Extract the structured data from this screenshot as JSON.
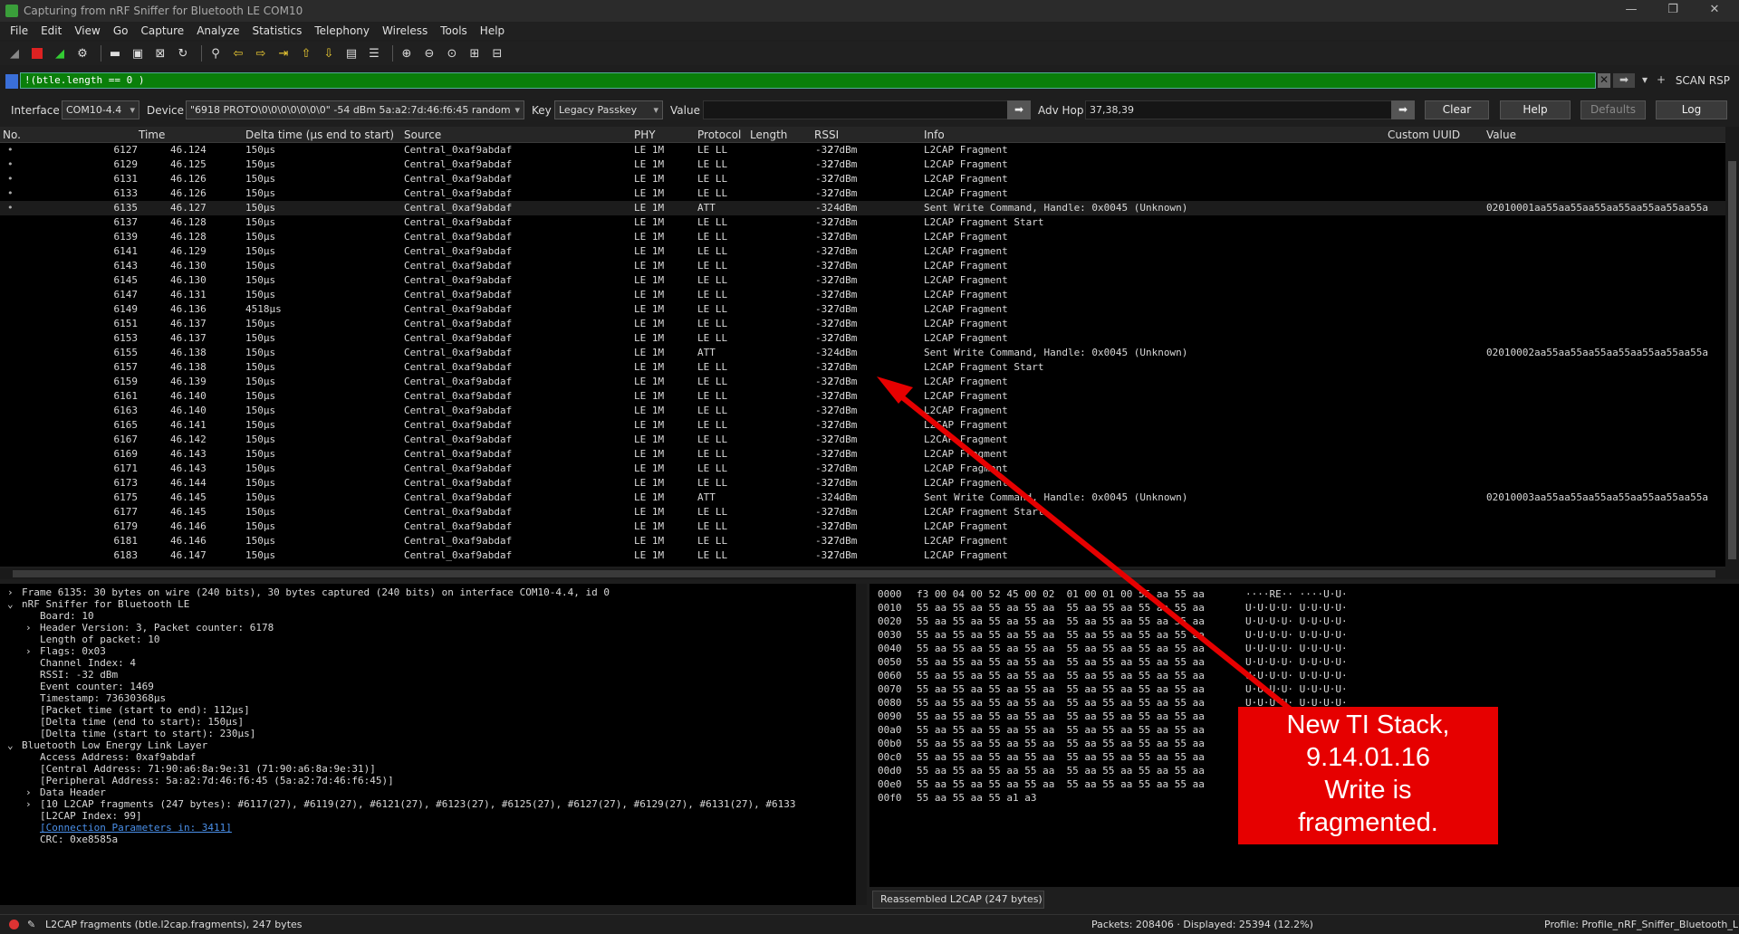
{
  "window": {
    "title": "Capturing from nRF Sniffer for Bluetooth LE COM10"
  },
  "menu": [
    "File",
    "Edit",
    "View",
    "Go",
    "Capture",
    "Analyze",
    "Statistics",
    "Telephony",
    "Wireless",
    "Tools",
    "Help"
  ],
  "filter": {
    "value": "!(btle.length == 0 )",
    "scan_rsp": "SCAN RSP"
  },
  "controls": {
    "interface_label": "Interface",
    "interface_value": "COM10-4.4",
    "device_label": "Device",
    "device_value": "\"6918 PROTO\\0\\0\\0\\0\\0\\0\\0\"  -54 dBm  5a:a2:7d:46:f6:45  random",
    "key_label": "Key",
    "key_value": "Legacy Passkey",
    "value_label": "Value",
    "adv_hop_label": "Adv Hop",
    "adv_hop_value": "37,38,39",
    "clear": "Clear",
    "help": "Help",
    "defaults": "Defaults",
    "log": "Log"
  },
  "columns": [
    "No.",
    "Time",
    "Delta time (µs end to start)",
    "Source",
    "PHY",
    "Protocol",
    "Length",
    "RSSI",
    "Info",
    "Custom UUID",
    "Value"
  ],
  "packets": [
    {
      "no": "6127",
      "time": "46.124",
      "delta": "150µs",
      "src": "Central_0xaf9abdaf",
      "phy": "LE 1M",
      "proto": "LE LL",
      "len": "27",
      "rssi": "-32 dBm",
      "info": "L2CAP Fragment",
      "value": ""
    },
    {
      "no": "6129",
      "time": "46.125",
      "delta": "150µs",
      "src": "Central_0xaf9abdaf",
      "phy": "LE 1M",
      "proto": "LE LL",
      "len": "27",
      "rssi": "-32 dBm",
      "info": "L2CAP Fragment",
      "value": ""
    },
    {
      "no": "6131",
      "time": "46.126",
      "delta": "150µs",
      "src": "Central_0xaf9abdaf",
      "phy": "LE 1M",
      "proto": "LE LL",
      "len": "27",
      "rssi": "-32 dBm",
      "info": "L2CAP Fragment",
      "value": ""
    },
    {
      "no": "6133",
      "time": "46.126",
      "delta": "150µs",
      "src": "Central_0xaf9abdaf",
      "phy": "LE 1M",
      "proto": "LE LL",
      "len": "27",
      "rssi": "-32 dBm",
      "info": "L2CAP Fragment",
      "value": ""
    },
    {
      "no": "6135",
      "time": "46.127",
      "delta": "150µs",
      "src": "Central_0xaf9abdaf",
      "phy": "LE 1M",
      "proto": "ATT",
      "len": "4",
      "rssi": "-32 dBm",
      "info": "Sent Write Command, Handle: 0x0045 (Unknown)",
      "value": "02010001aa55aa55aa55aa55aa55aa55aa55a"
    },
    {
      "no": "6137",
      "time": "46.128",
      "delta": "150µs",
      "src": "Central_0xaf9abdaf",
      "phy": "LE 1M",
      "proto": "LE LL",
      "len": "27",
      "rssi": "-32 dBm",
      "info": "L2CAP Fragment Start",
      "value": ""
    },
    {
      "no": "6139",
      "time": "46.128",
      "delta": "150µs",
      "src": "Central_0xaf9abdaf",
      "phy": "LE 1M",
      "proto": "LE LL",
      "len": "27",
      "rssi": "-32 dBm",
      "info": "L2CAP Fragment",
      "value": ""
    },
    {
      "no": "6141",
      "time": "46.129",
      "delta": "150µs",
      "src": "Central_0xaf9abdaf",
      "phy": "LE 1M",
      "proto": "LE LL",
      "len": "27",
      "rssi": "-32 dBm",
      "info": "L2CAP Fragment",
      "value": ""
    },
    {
      "no": "6143",
      "time": "46.130",
      "delta": "150µs",
      "src": "Central_0xaf9abdaf",
      "phy": "LE 1M",
      "proto": "LE LL",
      "len": "27",
      "rssi": "-32 dBm",
      "info": "L2CAP Fragment",
      "value": ""
    },
    {
      "no": "6145",
      "time": "46.130",
      "delta": "150µs",
      "src": "Central_0xaf9abdaf",
      "phy": "LE 1M",
      "proto": "LE LL",
      "len": "27",
      "rssi": "-32 dBm",
      "info": "L2CAP Fragment",
      "value": ""
    },
    {
      "no": "6147",
      "time": "46.131",
      "delta": "150µs",
      "src": "Central_0xaf9abdaf",
      "phy": "LE 1M",
      "proto": "LE LL",
      "len": "27",
      "rssi": "-32 dBm",
      "info": "L2CAP Fragment",
      "value": ""
    },
    {
      "no": "6149",
      "time": "46.136",
      "delta": "4518µs",
      "src": "Central_0xaf9abdaf",
      "phy": "LE 1M",
      "proto": "LE LL",
      "len": "27",
      "rssi": "-32 dBm",
      "info": "L2CAP Fragment",
      "value": ""
    },
    {
      "no": "6151",
      "time": "46.137",
      "delta": "150µs",
      "src": "Central_0xaf9abdaf",
      "phy": "LE 1M",
      "proto": "LE LL",
      "len": "27",
      "rssi": "-32 dBm",
      "info": "L2CAP Fragment",
      "value": ""
    },
    {
      "no": "6153",
      "time": "46.137",
      "delta": "150µs",
      "src": "Central_0xaf9abdaf",
      "phy": "LE 1M",
      "proto": "LE LL",
      "len": "27",
      "rssi": "-32 dBm",
      "info": "L2CAP Fragment",
      "value": ""
    },
    {
      "no": "6155",
      "time": "46.138",
      "delta": "150µs",
      "src": "Central_0xaf9abdaf",
      "phy": "LE 1M",
      "proto": "ATT",
      "len": "4",
      "rssi": "-32 dBm",
      "info": "Sent Write Command, Handle: 0x0045 (Unknown)",
      "value": "02010002aa55aa55aa55aa55aa55aa55aa55a"
    },
    {
      "no": "6157",
      "time": "46.138",
      "delta": "150µs",
      "src": "Central_0xaf9abdaf",
      "phy": "LE 1M",
      "proto": "LE LL",
      "len": "27",
      "rssi": "-32 dBm",
      "info": "L2CAP Fragment Start",
      "value": ""
    },
    {
      "no": "6159",
      "time": "46.139",
      "delta": "150µs",
      "src": "Central_0xaf9abdaf",
      "phy": "LE 1M",
      "proto": "LE LL",
      "len": "27",
      "rssi": "-32 dBm",
      "info": "L2CAP Fragment",
      "value": ""
    },
    {
      "no": "6161",
      "time": "46.140",
      "delta": "150µs",
      "src": "Central_0xaf9abdaf",
      "phy": "LE 1M",
      "proto": "LE LL",
      "len": "27",
      "rssi": "-32 dBm",
      "info": "L2CAP Fragment",
      "value": ""
    },
    {
      "no": "6163",
      "time": "46.140",
      "delta": "150µs",
      "src": "Central_0xaf9abdaf",
      "phy": "LE 1M",
      "proto": "LE LL",
      "len": "27",
      "rssi": "-32 dBm",
      "info": "L2CAP Fragment",
      "value": ""
    },
    {
      "no": "6165",
      "time": "46.141",
      "delta": "150µs",
      "src": "Central_0xaf9abdaf",
      "phy": "LE 1M",
      "proto": "LE LL",
      "len": "27",
      "rssi": "-32 dBm",
      "info": "L2CAP Fragment",
      "value": ""
    },
    {
      "no": "6167",
      "time": "46.142",
      "delta": "150µs",
      "src": "Central_0xaf9abdaf",
      "phy": "LE 1M",
      "proto": "LE LL",
      "len": "27",
      "rssi": "-32 dBm",
      "info": "L2CAP Fragment",
      "value": ""
    },
    {
      "no": "6169",
      "time": "46.143",
      "delta": "150µs",
      "src": "Central_0xaf9abdaf",
      "phy": "LE 1M",
      "proto": "LE LL",
      "len": "27",
      "rssi": "-32 dBm",
      "info": "L2CAP Fragment",
      "value": ""
    },
    {
      "no": "6171",
      "time": "46.143",
      "delta": "150µs",
      "src": "Central_0xaf9abdaf",
      "phy": "LE 1M",
      "proto": "LE LL",
      "len": "27",
      "rssi": "-32 dBm",
      "info": "L2CAP Fragment",
      "value": ""
    },
    {
      "no": "6173",
      "time": "46.144",
      "delta": "150µs",
      "src": "Central_0xaf9abdaf",
      "phy": "LE 1M",
      "proto": "LE LL",
      "len": "27",
      "rssi": "-32 dBm",
      "info": "L2CAP Fragment",
      "value": ""
    },
    {
      "no": "6175",
      "time": "46.145",
      "delta": "150µs",
      "src": "Central_0xaf9abdaf",
      "phy": "LE 1M",
      "proto": "ATT",
      "len": "4",
      "rssi": "-32 dBm",
      "info": "Sent Write Command, Handle: 0x0045 (Unknown)",
      "value": "02010003aa55aa55aa55aa55aa55aa55aa55a"
    },
    {
      "no": "6177",
      "time": "46.145",
      "delta": "150µs",
      "src": "Central_0xaf9abdaf",
      "phy": "LE 1M",
      "proto": "LE LL",
      "len": "27",
      "rssi": "-32 dBm",
      "info": "L2CAP Fragment Start",
      "value": ""
    },
    {
      "no": "6179",
      "time": "46.146",
      "delta": "150µs",
      "src": "Central_0xaf9abdaf",
      "phy": "LE 1M",
      "proto": "LE LL",
      "len": "27",
      "rssi": "-32 dBm",
      "info": "L2CAP Fragment",
      "value": ""
    },
    {
      "no": "6181",
      "time": "46.146",
      "delta": "150µs",
      "src": "Central_0xaf9abdaf",
      "phy": "LE 1M",
      "proto": "LE LL",
      "len": "27",
      "rssi": "-32 dBm",
      "info": "L2CAP Fragment",
      "value": ""
    },
    {
      "no": "6183",
      "time": "46.147",
      "delta": "150µs",
      "src": "Central_0xaf9abdaf",
      "phy": "LE 1M",
      "proto": "LE LL",
      "len": "27",
      "rssi": "-32 dBm",
      "info": "L2CAP Fragment",
      "value": ""
    }
  ],
  "details": [
    {
      "indent": 0,
      "tw": "›",
      "text": "Frame 6135: 30 bytes on wire (240 bits), 30 bytes captured (240 bits) on interface COM10-4.4, id 0"
    },
    {
      "indent": 0,
      "tw": "⌄",
      "text": "nRF Sniffer for Bluetooth LE"
    },
    {
      "indent": 1,
      "tw": "",
      "text": "Board: 10"
    },
    {
      "indent": 1,
      "tw": "›",
      "text": "Header Version: 3, Packet counter: 6178"
    },
    {
      "indent": 1,
      "tw": "",
      "text": "Length of packet: 10"
    },
    {
      "indent": 1,
      "tw": "›",
      "text": "Flags: 0x03"
    },
    {
      "indent": 1,
      "tw": "",
      "text": "Channel Index: 4"
    },
    {
      "indent": 1,
      "tw": "",
      "text": "RSSI: -32 dBm"
    },
    {
      "indent": 1,
      "tw": "",
      "text": "Event counter: 1469"
    },
    {
      "indent": 1,
      "tw": "",
      "text": "Timestamp: 73630368µs"
    },
    {
      "indent": 1,
      "tw": "",
      "text": "[Packet time (start to end): 112µs]"
    },
    {
      "indent": 1,
      "tw": "",
      "text": "[Delta time (end to start): 150µs]"
    },
    {
      "indent": 1,
      "tw": "",
      "text": "[Delta time (start to start): 230µs]"
    },
    {
      "indent": 0,
      "tw": "⌄",
      "text": "Bluetooth Low Energy Link Layer"
    },
    {
      "indent": 1,
      "tw": "",
      "text": "Access Address: 0xaf9abdaf"
    },
    {
      "indent": 1,
      "tw": "",
      "text": "[Central Address: 71:90:a6:8a:9e:31 (71:90:a6:8a:9e:31)]"
    },
    {
      "indent": 1,
      "tw": "",
      "text": "[Peripheral Address: 5a:a2:7d:46:f6:45 (5a:a2:7d:46:f6:45)]"
    },
    {
      "indent": 1,
      "tw": "›",
      "text": "Data Header"
    },
    {
      "indent": 1,
      "tw": "›",
      "text": "[10 L2CAP fragments (247 bytes): #6117(27), #6119(27), #6121(27), #6123(27), #6125(27), #6127(27), #6129(27), #6131(27), #6133"
    },
    {
      "indent": 1,
      "tw": "",
      "text": "[L2CAP Index: 99]"
    },
    {
      "indent": 1,
      "tw": "",
      "text": "[Connection Parameters in: 3411]",
      "link": true
    },
    {
      "indent": 1,
      "tw": "",
      "text": "CRC: 0xe8585a"
    }
  ],
  "hex_rows": [
    {
      "off": "0000",
      "bytes": "f3 00 04 00 52 45 00 02  01 00 01 00 55 aa 55 aa",
      "ascii": "····RE·· ····U·U·"
    },
    {
      "off": "0010",
      "bytes": "55 aa 55 aa 55 aa 55 aa  55 aa 55 aa 55 aa 55 aa",
      "ascii": "U·U·U·U· U·U·U·U·"
    },
    {
      "off": "0020",
      "bytes": "55 aa 55 aa 55 aa 55 aa  55 aa 55 aa 55 aa 55 aa",
      "ascii": "U·U·U·U· U·U·U·U·"
    },
    {
      "off": "0030",
      "bytes": "55 aa 55 aa 55 aa 55 aa  55 aa 55 aa 55 aa 55 aa",
      "ascii": "U·U·U·U· U·U·U·U·"
    },
    {
      "off": "0040",
      "bytes": "55 aa 55 aa 55 aa 55 aa  55 aa 55 aa 55 aa 55 aa",
      "ascii": "U·U·U·U· U·U·U·U·"
    },
    {
      "off": "0050",
      "bytes": "55 aa 55 aa 55 aa 55 aa  55 aa 55 aa 55 aa 55 aa",
      "ascii": "U·U·U·U· U·U·U·U·"
    },
    {
      "off": "0060",
      "bytes": "55 aa 55 aa 55 aa 55 aa  55 aa 55 aa 55 aa 55 aa",
      "ascii": "U·U·U·U· U·U·U·U·"
    },
    {
      "off": "0070",
      "bytes": "55 aa 55 aa 55 aa 55 aa  55 aa 55 aa 55 aa 55 aa",
      "ascii": "U·U·U·U· U·U·U·U·"
    },
    {
      "off": "0080",
      "bytes": "55 aa 55 aa 55 aa 55 aa  55 aa 55 aa 55 aa 55 aa",
      "ascii": "U·U·U·U· U·U·U·U·"
    },
    {
      "off": "0090",
      "bytes": "55 aa 55 aa 55 aa 55 aa  55 aa 55 aa 55 aa 55 aa",
      "ascii": ""
    },
    {
      "off": "00a0",
      "bytes": "55 aa 55 aa 55 aa 55 aa  55 aa 55 aa 55 aa 55 aa",
      "ascii": ""
    },
    {
      "off": "00b0",
      "bytes": "55 aa 55 aa 55 aa 55 aa  55 aa 55 aa 55 aa 55 aa",
      "ascii": ""
    },
    {
      "off": "00c0",
      "bytes": "55 aa 55 aa 55 aa 55 aa  55 aa 55 aa 55 aa 55 aa",
      "ascii": ""
    },
    {
      "off": "00d0",
      "bytes": "55 aa 55 aa 55 aa 55 aa  55 aa 55 aa 55 aa 55 aa",
      "ascii": ""
    },
    {
      "off": "00e0",
      "bytes": "55 aa 55 aa 55 aa 55 aa  55 aa 55 aa 55 aa 55 aa",
      "ascii": ""
    },
    {
      "off": "00f0",
      "bytes": "55 aa 55 aa 55 a1 a3",
      "ascii": ""
    }
  ],
  "hex_tab": "Reassembled L2CAP (247 bytes)",
  "status": {
    "left": "L2CAP fragments (btle.l2cap.fragments), 247 bytes",
    "packets": "Packets: 208406 · Displayed: 25394 (12.2%)",
    "profile": "Profile: Profile_nRF_Sniffer_Bluetooth_LE"
  },
  "annotation": {
    "line1": "New TI Stack,",
    "line2": "9.14.01.16",
    "line3": "Write is",
    "line4": "fragmented.",
    "color": "#e60000"
  }
}
